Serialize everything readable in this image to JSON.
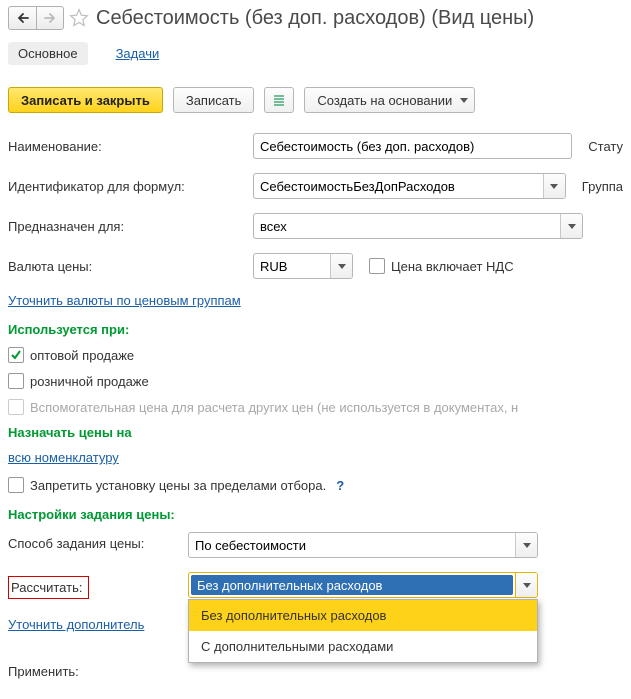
{
  "header": {
    "title": "Себестоимость (без доп. расходов) (Вид цены)"
  },
  "tabs": {
    "main": "Основное",
    "tasks": "Задачи"
  },
  "cmd": {
    "save_close": "Записать и закрыть",
    "save": "Записать",
    "create_based": "Создать на основании"
  },
  "fields": {
    "name_label": "Наименование:",
    "name_value": "Себестоимость (без доп. расходов)",
    "status_label": "Стату",
    "id_label": "Идентификатор для формул:",
    "id_value": "СебестоимостьБезДопРасходов",
    "group_label": "Группа",
    "for_label": "Предназначен для:",
    "for_value": "всех",
    "currency_label": "Валюта цены:",
    "currency_value": "RUB",
    "includes_vat": "Цена включает НДС",
    "refine_currencies": "Уточнить валюты по ценовым группам"
  },
  "used_when": {
    "header": "Используется при:",
    "opt": "оптовой продаже",
    "retail": "розничной продаже",
    "aux": "Вспомогательная цена для расчета других цен (не используется в документах, н"
  },
  "assign": {
    "header": "Назначать цены на",
    "all_nom": "всю номенклатуру",
    "forbid": "Запретить установку цены за пределами отбора."
  },
  "settings": {
    "header": "Настройки задания цены:",
    "method_label": "Способ задания цены:",
    "method_value": "По себестоимости",
    "calc_label": "Рассчитать:",
    "calc_value": "Без дополнительных расходов",
    "dd_opt1": "Без дополнительных расходов",
    "dd_opt2": "С дополнительными расходами",
    "refine_add": "Уточнить дополнитель",
    "apply_label": "Применить:"
  }
}
